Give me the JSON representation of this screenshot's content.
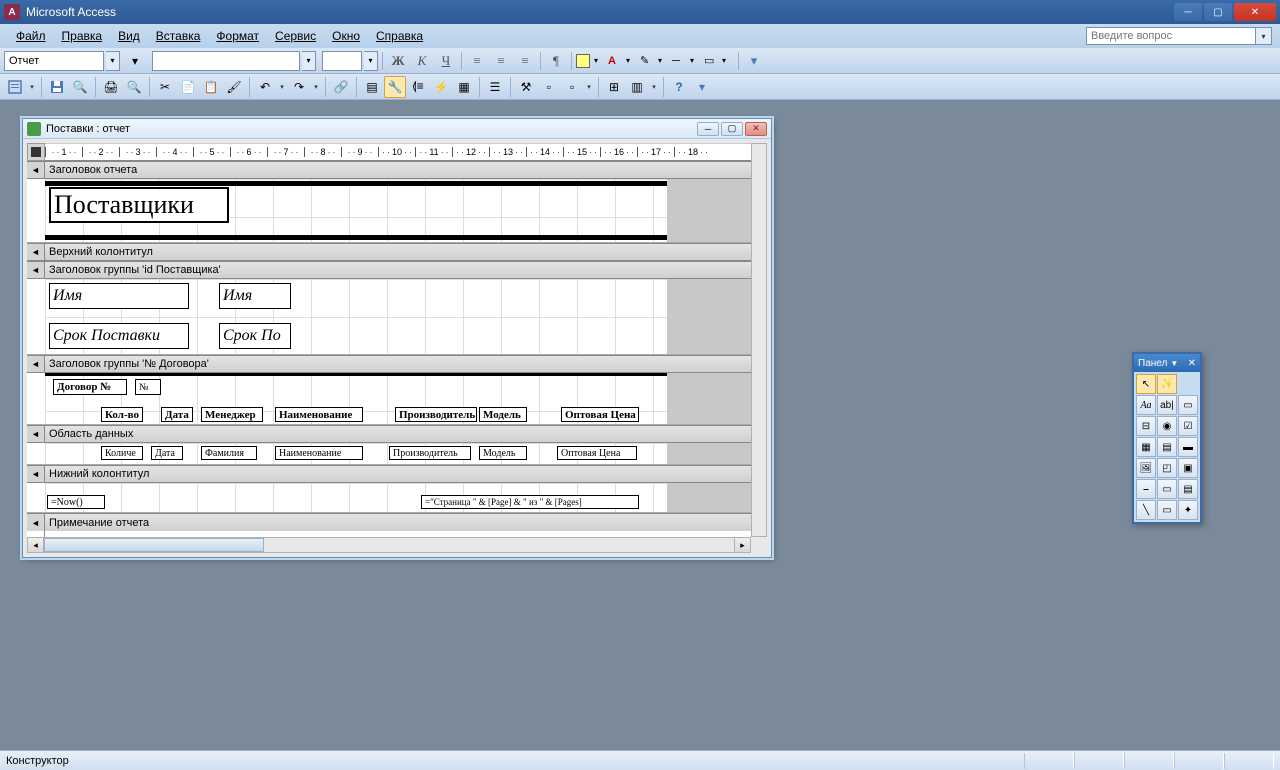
{
  "app": {
    "title": "Microsoft Access"
  },
  "menu": {
    "file": "Файл",
    "edit": "Правка",
    "view": "Вид",
    "insert": "Вставка",
    "format": "Формат",
    "tools": "Сервис",
    "window": "Окно",
    "help": "Справка"
  },
  "question_placeholder": "Введите вопрос",
  "format_toolbar": {
    "object_selector": "Отчет",
    "bold": "Ж",
    "italic": "К",
    "underline": "Ч"
  },
  "child": {
    "title": "Поставки : отчет"
  },
  "sections": {
    "report_header": "Заголовок отчета",
    "page_header": "Верхний колонтитул",
    "group1_header": "Заголовок группы 'id Поставщика'",
    "group2_header": "Заголовок группы '№ Договора'",
    "detail": "Область данных",
    "page_footer": "Нижний колонтитул",
    "report_footer": "Примечание отчета"
  },
  "controls": {
    "title": "Поставщики",
    "name_label": "Имя",
    "name_field": "Имя",
    "term_label": "Срок Поставки",
    "term_field": "Срок По",
    "contract_label": "Договор №",
    "contract_field": "№ ",
    "headers": {
      "qty": "Кол-во",
      "date": "Дата",
      "manager": "Менеджер",
      "item": "Наименование",
      "maker": "Производитель",
      "model": "Модель",
      "price": "Оптовая Цена"
    },
    "fields": {
      "qty": "Количе",
      "date": "Дата",
      "surname": "Фамилия",
      "item": "Наименование",
      "maker": "Производитель",
      "model": "Модель",
      "price": "Оптовая Цена"
    },
    "now": "=Now()",
    "pages": "=\"Страница \" & [Page] & \" из \" & [Pages]"
  },
  "toolbox": {
    "title": "Панел",
    "pointer": "↖",
    "wizard": "✨",
    "label": "Aa",
    "textbox": "ab|",
    "group": "▭",
    "toggle": "⊟",
    "option": "◉",
    "check": "☑",
    "combo": "▦",
    "list": "▤",
    "button": "▬",
    "image": "🖼",
    "frame": "▣",
    "unbound": "◰",
    "pagebreak": "⎯",
    "tab": "▭",
    "subform": "▤",
    "line": "╲",
    "rect": "▭",
    "more": "✦"
  },
  "status": "Конструктор"
}
